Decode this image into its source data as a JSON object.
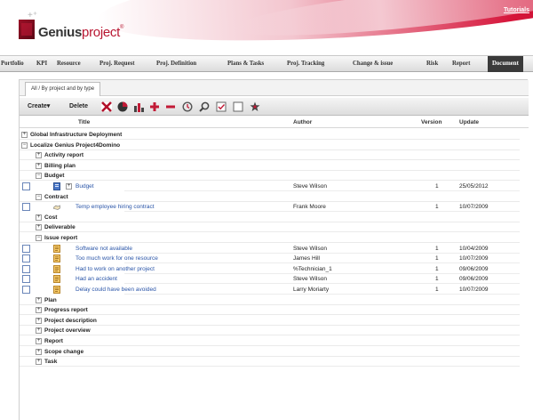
{
  "header": {
    "tutorials": "Tutorials",
    "logo_bold": "Genius",
    "logo_light": "project",
    "logo_reg": "®"
  },
  "nav": [
    {
      "label": "Portfolio"
    },
    {
      "label": "KPI"
    },
    {
      "label": "Resource"
    },
    {
      "label": "Proj. Request"
    },
    {
      "label": "Proj. Definition"
    },
    {
      "label": "Plans & Tasks"
    },
    {
      "label": "Proj. Tracking"
    },
    {
      "label": "Change & issue"
    },
    {
      "label": "Risk"
    },
    {
      "label": "Report"
    },
    {
      "label": "Document",
      "active": true
    }
  ],
  "tab": {
    "label": "All / By project and by type"
  },
  "toolbar": {
    "create_label": "Create▾",
    "delete_label": "Delete",
    "icons": [
      "excel-icon",
      "pie-chart-icon",
      "bar-chart-icon",
      "add-icon",
      "remove-icon",
      "history-icon",
      "search-icon",
      "check-icon",
      "uncheck-icon",
      "star-icon"
    ]
  },
  "columns": {
    "title": "Title",
    "author": "Author",
    "version": "Version",
    "update": "Update"
  },
  "colors": {
    "link": "#2a55a8",
    "accent": "#c21a36",
    "nav_active": "#3a3a3a"
  },
  "rows": [
    {
      "kind": "group",
      "level": 0,
      "expander": "+",
      "label": "Global Infrastructure Deployment"
    },
    {
      "kind": "group",
      "level": 0,
      "expander": "−",
      "label": "Localize Genius Project4Domino"
    },
    {
      "kind": "group",
      "level": 1,
      "expander": "+",
      "label": "Activity report"
    },
    {
      "kind": "group",
      "level": 1,
      "expander": "+",
      "label": "Billing plan"
    },
    {
      "kind": "group",
      "level": 1,
      "expander": "−",
      "label": "Budget"
    },
    {
      "kind": "doc",
      "icon": "blue-document-icon",
      "expander": "+",
      "title": "Budget",
      "author": "Steve Wilson",
      "version": "1",
      "update": "25/05/2012"
    },
    {
      "kind": "group",
      "level": 1,
      "expander": "−",
      "label": "Contract"
    },
    {
      "kind": "doc",
      "icon": "handshake-icon",
      "title": "Temp employee hiring contract",
      "author": "Frank Moore",
      "version": "1",
      "update": "10/07/2009"
    },
    {
      "kind": "group",
      "level": 1,
      "expander": "+",
      "label": "Cost"
    },
    {
      "kind": "group",
      "level": 1,
      "expander": "+",
      "label": "Deliverable"
    },
    {
      "kind": "group",
      "level": 1,
      "expander": "−",
      "label": "Issue report"
    },
    {
      "kind": "doc",
      "icon": "issue-document-icon",
      "title": "Software not available",
      "author": "Steve Wilson",
      "version": "1",
      "update": "10/04/2009"
    },
    {
      "kind": "doc",
      "icon": "issue-document-icon",
      "title": "Too much work for one resource",
      "author": "James Hill",
      "version": "1",
      "update": "10/07/2009"
    },
    {
      "kind": "doc",
      "icon": "issue-document-icon",
      "title": "Had to work on another project",
      "author": "%Technician_1",
      "version": "1",
      "update": "09/06/2009"
    },
    {
      "kind": "doc",
      "icon": "issue-document-icon",
      "title": "Had an accident",
      "author": "Steve Wilson",
      "version": "1",
      "update": "09/06/2009"
    },
    {
      "kind": "doc",
      "icon": "issue-document-icon",
      "title": "Delay could have been avoided",
      "author": "Larry Moriarty",
      "version": "1",
      "update": "10/07/2009"
    },
    {
      "kind": "group",
      "level": 1,
      "expander": "+",
      "label": "Plan"
    },
    {
      "kind": "group",
      "level": 1,
      "expander": "+",
      "label": "Progress report"
    },
    {
      "kind": "group",
      "level": 1,
      "expander": "+",
      "label": "Project description"
    },
    {
      "kind": "group",
      "level": 1,
      "expander": "+",
      "label": "Project overview"
    },
    {
      "kind": "group",
      "level": 1,
      "expander": "+",
      "label": "Report"
    },
    {
      "kind": "group",
      "level": 1,
      "expander": "+",
      "label": "Scope change"
    },
    {
      "kind": "group",
      "level": 1,
      "expander": "+",
      "label": "Task"
    }
  ]
}
